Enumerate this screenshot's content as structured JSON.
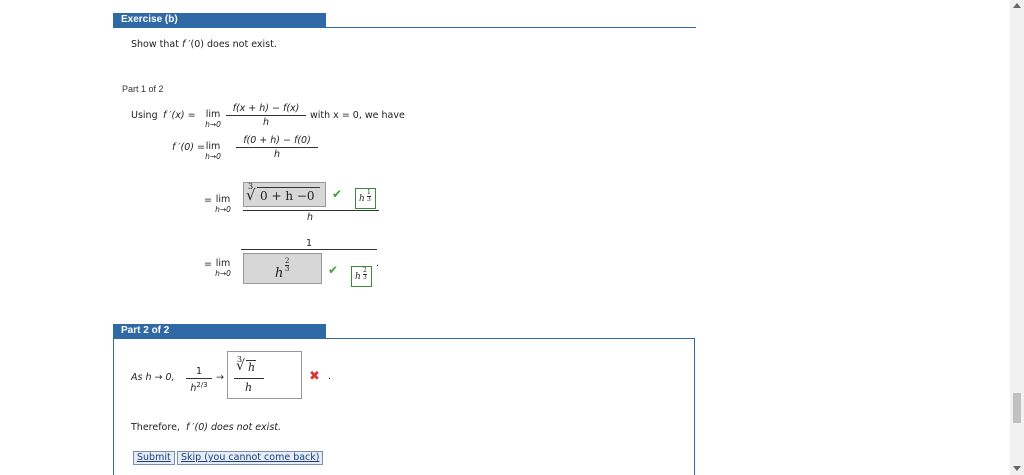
{
  "exercise": {
    "header": "Exercise (b)",
    "prompt_pre": "Show that ",
    "prompt_fn": "f",
    "prompt_post": " ′(0) does not exist."
  },
  "part1": {
    "label": "Part 1 of 2",
    "using": "Using",
    "f_prime_x": "f ′(x) =",
    "lim": "lim",
    "lim_sub": "h→0",
    "def_num": "f(x + h) − f(x)",
    "def_den": "h",
    "with_text": "with x = 0, we have",
    "f_prime_0": "f ′(0) =",
    "step1_num": "f(0 + h) − f(0)",
    "step1_den": "h",
    "eq": "=",
    "step2_root_index": "3",
    "step2_answer": "0 + h −0",
    "step2_den": "h",
    "step2_hint_base": "h",
    "step2_hint_exp_num": "1",
    "step2_hint_exp_den": "3",
    "step3_num": "1",
    "step3_answer_base": "h",
    "step3_answer_exp_num": "2",
    "step3_answer_exp_den": "3",
    "step3_hint_base": "h",
    "step3_hint_exp_num": "2",
    "step3_hint_exp_den": "3",
    "period": "."
  },
  "part2": {
    "header": "Part 2 of 2",
    "as_text": "As h → 0,",
    "frac_num": "1",
    "frac_den": "h",
    "frac_den_exp": "2/3",
    "arrow": "→",
    "answer_root_index": "3",
    "answer_radicand": "h",
    "answer_den": "h",
    "after_mark": ".",
    "therefore": "Therefore,",
    "therefore_fn": "f ′(0) does not exist."
  },
  "buttons": {
    "submit": "Submit",
    "skip": "Skip (you cannot come back)"
  },
  "colors": {
    "header_bg": "#2f6aa6",
    "correct": "#3aa13a",
    "incorrect": "#d33333"
  },
  "icons": {
    "check": "checkmark-icon",
    "cross": "cross-icon"
  }
}
